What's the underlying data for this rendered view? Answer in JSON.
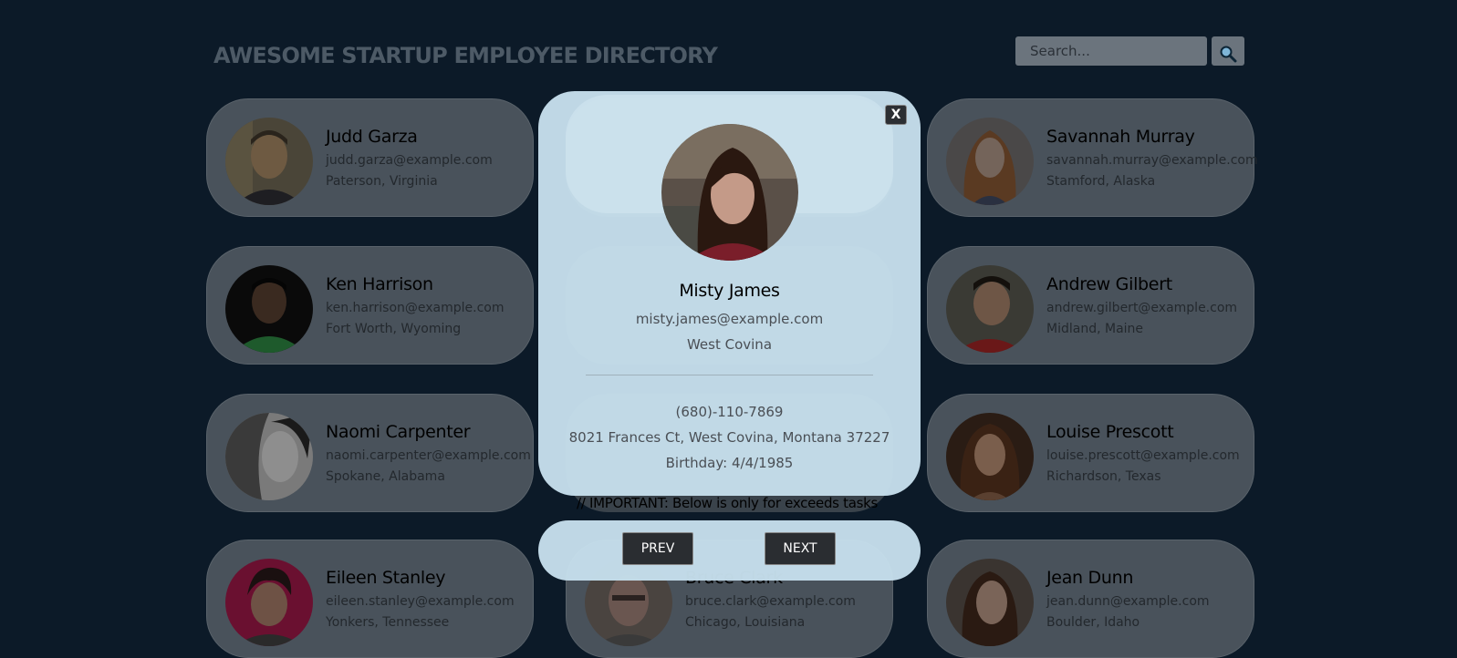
{
  "header": {
    "title": "AWESOME STARTUP EMPLOYEE DIRECTORY",
    "search_placeholder": "Search..."
  },
  "employees": [
    {
      "name": "Judd Garza",
      "email": "judd.garza@example.com",
      "location": "Paterson, Virginia"
    },
    {
      "name": "Savannah Murray",
      "email": "savannah.murray@example.com",
      "location": "Stamford, Alaska"
    },
    {
      "name": "Ken Harrison",
      "email": "ken.harrison@example.com",
      "location": "Fort Worth, Wyoming"
    },
    {
      "name": "Andrew Gilbert",
      "email": "andrew.gilbert@example.com",
      "location": "Midland, Maine"
    },
    {
      "name": "Naomi Carpenter",
      "email": "naomi.carpenter@example.com",
      "location": "Spokane, Alabama"
    },
    {
      "name": "Louise Prescott",
      "email": "louise.prescott@example.com",
      "location": "Richardson, Texas"
    },
    {
      "name": "Eileen Stanley",
      "email": "eileen.stanley@example.com",
      "location": "Yonkers, Tennessee"
    },
    {
      "name": "Bruce Clark",
      "email": "bruce.clark@example.com",
      "location": "Chicago, Louisiana"
    },
    {
      "name": "Jean Dunn",
      "email": "jean.dunn@example.com",
      "location": "Boulder, Idaho"
    }
  ],
  "important_note": "// IMPORTANT: Below is only for exceeds tasks",
  "modal": {
    "close_label": "X",
    "name": "Misty James",
    "email": "misty.james@example.com",
    "city": "West Covina",
    "phone": "(680)-110-7869",
    "address": "8021 Frances Ct, West Covina, Montana 37227",
    "birthday": "Birthday: 4/4/1985"
  },
  "navigation": {
    "prev_label": "PREV",
    "next_label": "NEXT"
  },
  "colors": {
    "background": "#0c1a28",
    "card": "#49525b",
    "modal": "#c5deeb",
    "button": "#2a2d31"
  }
}
